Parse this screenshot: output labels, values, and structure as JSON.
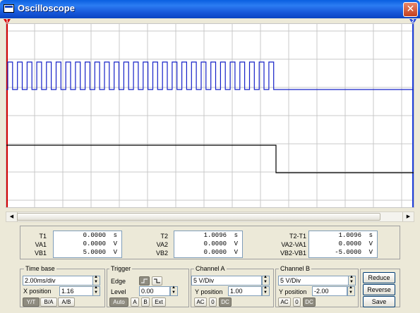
{
  "window": {
    "title": "Oscilloscope",
    "close_glyph": "✕"
  },
  "cursors": {
    "t1_label": "1",
    "t2_label": "2",
    "t1_color": "#D40000",
    "t2_color": "#1F3FD8"
  },
  "trace_colors": {
    "channel_a": "#1420C8",
    "channel_b": "#000000"
  },
  "readouts": {
    "t1": {
      "label": "T1",
      "time": "0.0000",
      "time_unit": "s",
      "va_label": "VA1",
      "va": "0.0000",
      "va_unit": "V",
      "vb_label": "VB1",
      "vb": "5.0000",
      "vb_unit": "V"
    },
    "t2": {
      "label": "T2",
      "time": "1.0096",
      "time_unit": "s",
      "va_label": "VA2",
      "va": "0.0000",
      "va_unit": "V",
      "vb_label": "VB2",
      "vb": "0.0000",
      "vb_unit": "V"
    },
    "diff": {
      "label": "T2-T1",
      "time": "1.0096",
      "time_unit": "s",
      "va_label": "VA2-VA1",
      "va": "0.0000",
      "va_unit": "V",
      "vb_label": "VB2-VB1",
      "vb": "-5.0000",
      "vb_unit": "V"
    }
  },
  "timebase": {
    "title": "Time base",
    "value": "2.00ms/div",
    "xpos_label": "X position",
    "xpos": "1.16",
    "modes": [
      "Y/T",
      "B/A",
      "A/B"
    ],
    "active_mode": "Y/T"
  },
  "trigger": {
    "title": "Trigger",
    "edge_label": "Edge",
    "level_label": "Level",
    "level": "0.00",
    "edge_icons": [
      "rising-edge-icon",
      "falling-edge-icon"
    ],
    "sources": [
      "Auto",
      "A",
      "B",
      "Ext"
    ],
    "active_source": "Auto"
  },
  "channel_a": {
    "title": "Channel A",
    "scale": "5 V/Div",
    "ypos_label": "Y position",
    "ypos": "1.00",
    "coupling": [
      "AC",
      "0",
      "DC"
    ],
    "active_coupling": "DC"
  },
  "channel_b": {
    "title": "Channel B",
    "scale": "5 V/Div",
    "ypos_label": "Y position",
    "ypos": "-2.00",
    "coupling": [
      "AC",
      "0",
      "DC"
    ],
    "active_coupling": "DC"
  },
  "actions": {
    "reduce": "Reduce",
    "reverse": "Reverse",
    "save": "Save"
  }
}
